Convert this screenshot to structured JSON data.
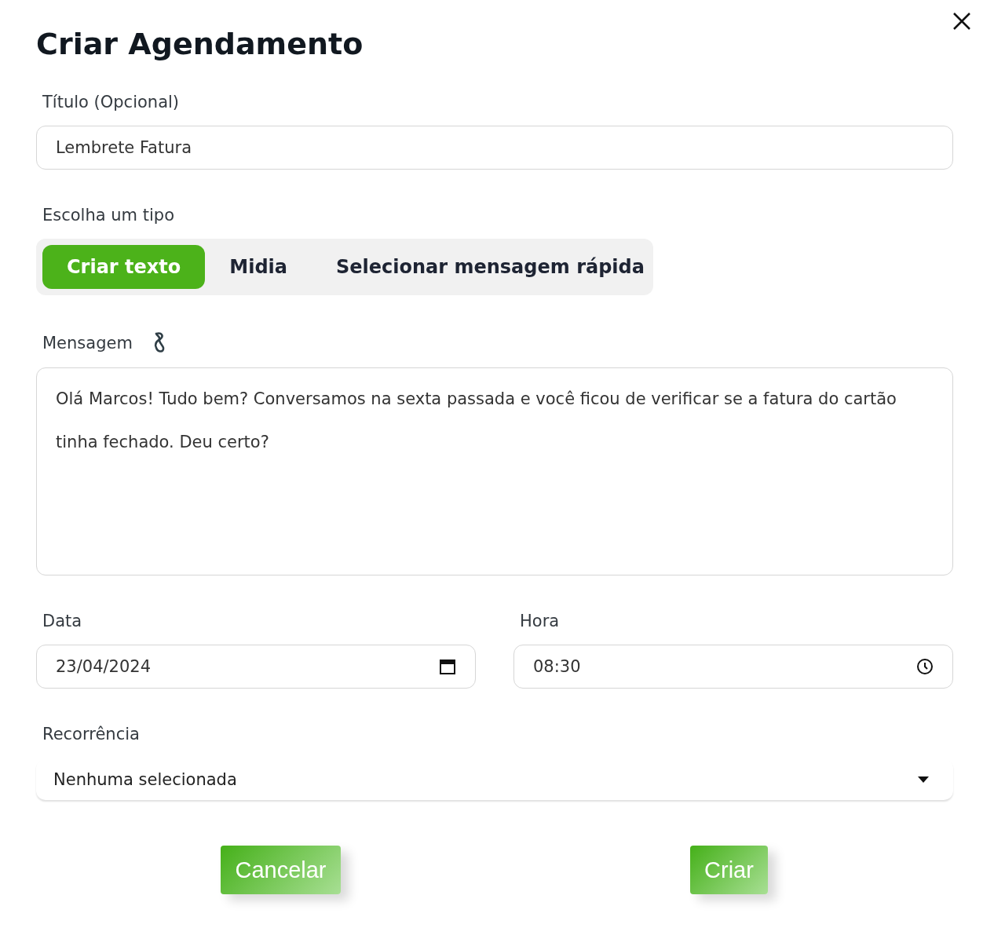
{
  "dialog": {
    "title": "Criar Agendamento"
  },
  "title_field": {
    "label": "Título (Opcional)",
    "value": "Lembrete Fatura"
  },
  "type_picker": {
    "label": "Escolha um tipo",
    "options": [
      {
        "label": "Criar texto",
        "selected": true
      },
      {
        "label": "Midia",
        "selected": false
      },
      {
        "label": "Selecionar mensagem rápida",
        "selected": false
      }
    ]
  },
  "message_field": {
    "label": "Mensagem",
    "value": "Olá Marcos! Tudo bem? Conversamos na sexta passada e você ficou de verificar se a fatura do cartão tinha fechado. Deu certo?"
  },
  "date_field": {
    "label": "Data",
    "value": "23/04/2024"
  },
  "time_field": {
    "label": "Hora",
    "value": "08:30"
  },
  "recurrence": {
    "label": "Recorrência",
    "value": "Nenhuma selecionada"
  },
  "buttons": [
    {
      "label": "Cancelar"
    },
    {
      "label": "Criar"
    }
  ]
}
